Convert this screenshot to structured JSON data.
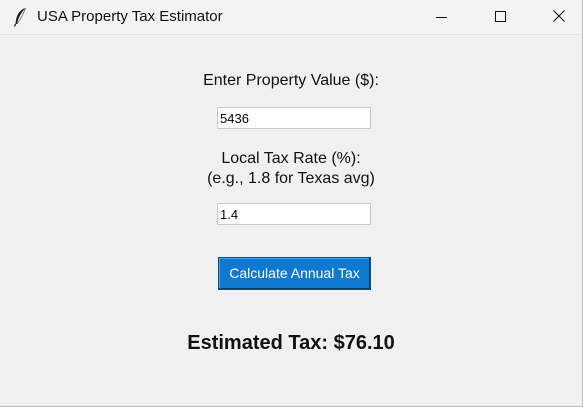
{
  "window": {
    "title": "USA Property Tax Estimator",
    "icon": "feather-icon",
    "controls": [
      "minimize-icon",
      "maximize-icon",
      "close-icon"
    ]
  },
  "form": {
    "property_value_label": "Enter Property Value ($):",
    "property_value": "5436",
    "tax_rate_label_line1": "Local Tax Rate (%):",
    "tax_rate_label_line2": "(e.g., 1.8 for Texas avg)",
    "tax_rate": "1.4",
    "calculate_button_label": "Calculate Annual Tax"
  },
  "result": {
    "text": "Estimated Tax: $76.10"
  },
  "colors": {
    "window_bg": "#f0f0f0",
    "button_bg": "#0f79d1",
    "button_text": "#ffffff"
  }
}
